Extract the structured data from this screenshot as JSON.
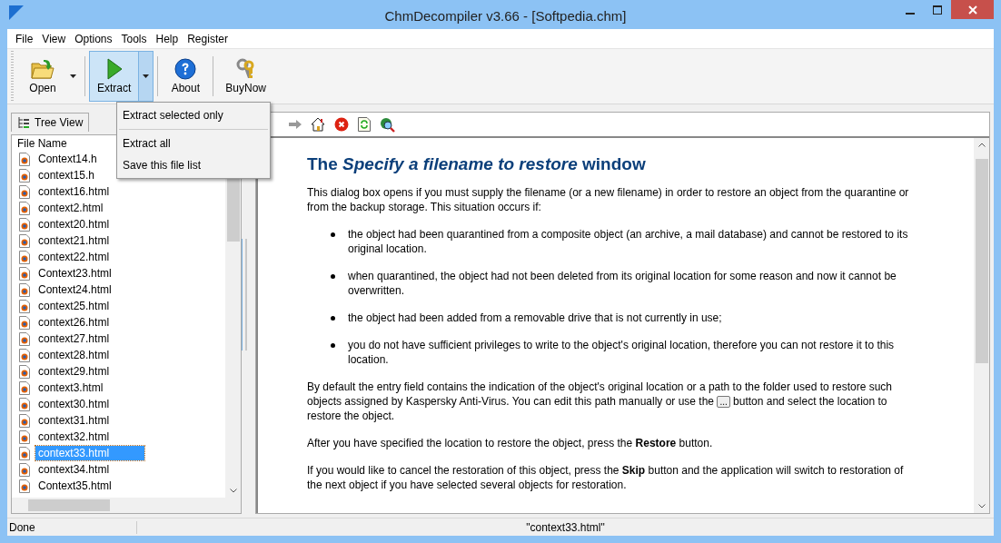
{
  "window": {
    "title": "ChmDecompiler v3.66 - [Softpedia.chm]"
  },
  "menu": [
    "File",
    "View",
    "Options",
    "Tools",
    "Help",
    "Register"
  ],
  "toolbar": [
    {
      "label": "Open",
      "kind": "open",
      "dropdown": true,
      "pressed": false
    },
    {
      "label": "Extract",
      "kind": "extract",
      "dropdown": true,
      "pressed": true
    },
    {
      "label": "About",
      "kind": "about",
      "dropdown": false,
      "pressed": false
    },
    {
      "label": "BuyNow",
      "kind": "buy",
      "dropdown": false,
      "pressed": false
    }
  ],
  "dropdown_menu": [
    "Extract selected only",
    "Extract all",
    "Save this file list"
  ],
  "left_panel": {
    "tab": "Tree View",
    "column": "File Name",
    "files": [
      {
        "name": "Context14.h",
        "selected": false
      },
      {
        "name": "context15.h",
        "selected": false
      },
      {
        "name": "context16.html",
        "selected": false
      },
      {
        "name": "context2.html",
        "selected": false
      },
      {
        "name": "context20.html",
        "selected": false
      },
      {
        "name": "context21.html",
        "selected": false
      },
      {
        "name": "context22.html",
        "selected": false
      },
      {
        "name": "Context23.html",
        "selected": false
      },
      {
        "name": "Context24.html",
        "selected": false
      },
      {
        "name": "context25.html",
        "selected": false
      },
      {
        "name": "context26.html",
        "selected": false
      },
      {
        "name": "context27.html",
        "selected": false
      },
      {
        "name": "context28.html",
        "selected": false
      },
      {
        "name": "context29.html",
        "selected": false
      },
      {
        "name": "context3.html",
        "selected": false
      },
      {
        "name": "context30.html",
        "selected": false
      },
      {
        "name": "context31.html",
        "selected": false
      },
      {
        "name": "context32.html",
        "selected": false
      },
      {
        "name": "context33.html",
        "selected": true
      },
      {
        "name": "context34.html",
        "selected": false
      },
      {
        "name": "Context35.html",
        "selected": false
      }
    ]
  },
  "document": {
    "heading": "The *Specify a filename to restore* window",
    "intro": "This dialog box opens if you must supply the filename (or a new filename) in order to restore an object from the quarantine or from the backup storage. This situation occurs if:",
    "bullets": [
      "the object had been quarantined from a composite object (an archive, a mail database) and cannot be restored to its original location.",
      "when quarantined, the object had not been deleted from its original location for some reason and now it cannot be overwritten.",
      "the object had been added from a removable drive that is not currently in use;",
      "you do not have sufficient privileges to write to the object's original location, therefore you can not restore it to this location."
    ],
    "paragraph_with_button": {
      "before": "By default the entry field contains the indication of the object's original location or a path to the folder used to restore such objects assigned by Kaspersky Anti-Virus. You can edit this path manually or use the",
      "button": "...",
      "after": "button and select the location to restore the object."
    },
    "paragraphs": [
      "After you have specified the location to restore the object, press the **Restore** button.",
      "If you would like to cancel the restoration of this object, press the **Skip** button and the application will switch to restoration of the next object if you have selected several objects for restoration."
    ]
  },
  "status_bar": [
    "Done",
    "\"context33.html\""
  ]
}
